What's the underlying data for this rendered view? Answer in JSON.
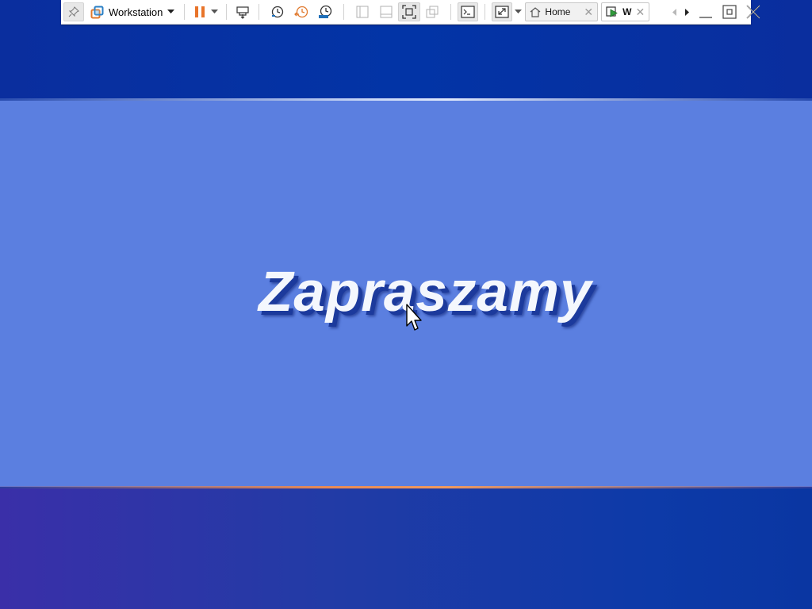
{
  "welcome": {
    "text": "Zapraszamy"
  },
  "toolbar": {
    "product_label": "Workstation",
    "tabs": [
      {
        "label": "Home",
        "icon": "home-icon"
      },
      {
        "label": "W",
        "icon": "vm-play-icon"
      }
    ],
    "icons": [
      "pin-icon",
      "vmware-logo-icon",
      "dropdown-arrow-icon",
      "pause-icon",
      "dropdown-arrow-icon",
      "send-ctrl-alt-del-icon",
      "snapshot-take-icon",
      "snapshot-revert-icon",
      "snapshot-manager-icon",
      "show-library-icon",
      "show-thumbnail-bar-icon",
      "full-screen-icon",
      "unity-icon",
      "console-view-icon",
      "stretch-guest-icon",
      "scroll-left-icon",
      "scroll-right-icon",
      "minimize-icon",
      "restore-icon",
      "close-icon"
    ]
  },
  "colors": {
    "xp_top_band": "#0234a6",
    "xp_middle": "#5b7fe0",
    "xp_orange_line": "#f19a5e",
    "pause_orange": "#e8742a",
    "snapshot_blue": "#1f6fb8"
  }
}
